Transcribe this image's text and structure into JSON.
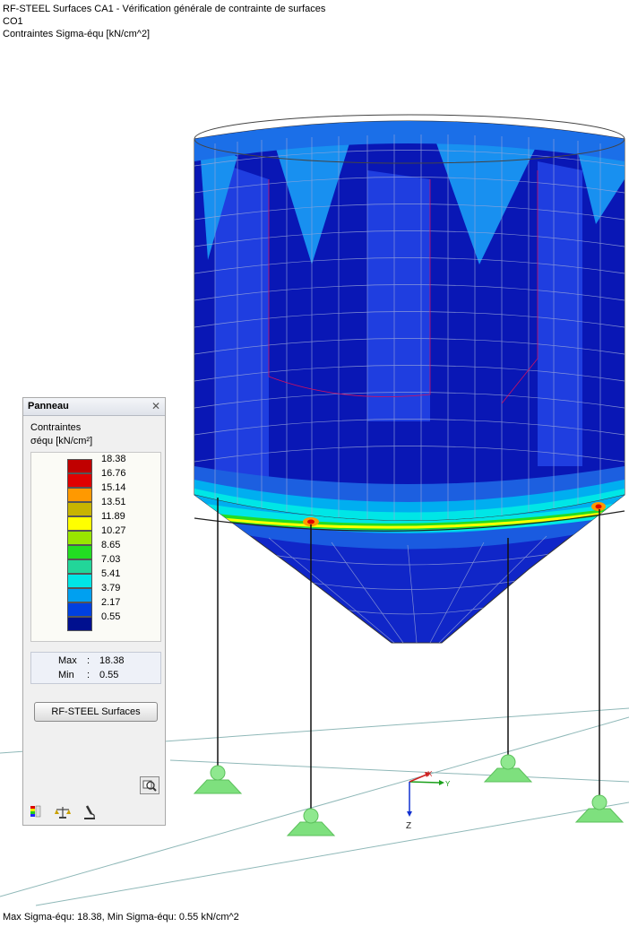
{
  "header": {
    "line1": "RF-STEEL Surfaces CA1 - Vérification générale de contrainte de surfaces",
    "line2": "CO1",
    "line3": "Contraintes Sigma-équ [kN/cm^2]"
  },
  "panel": {
    "title": "Panneau",
    "close_symbol": "✕",
    "section_label": "Contraintes",
    "unit_label": "σéqu [kN/cm²]",
    "legend": [
      {
        "value": "18.38",
        "color": "#c00000"
      },
      {
        "value": "16.76",
        "color": "#e00000"
      },
      {
        "value": "15.14",
        "color": "#ff9900"
      },
      {
        "value": "13.51",
        "color": "#c8b400"
      },
      {
        "value": "11.89",
        "color": "#ffff00"
      },
      {
        "value": "10.27",
        "color": "#99e600"
      },
      {
        "value": "8.65",
        "color": "#22dd22"
      },
      {
        "value": "7.03",
        "color": "#22d699"
      },
      {
        "value": "5.41",
        "color": "#00e6e6"
      },
      {
        "value": "3.79",
        "color": "#00a0f0"
      },
      {
        "value": "2.17",
        "color": "#0040e0"
      },
      {
        "value": "0.55",
        "color": "#00108f"
      }
    ],
    "max_label": "Max",
    "max_colon": ":",
    "max_value": "18.38",
    "min_label": "Min",
    "min_colon": ":",
    "min_value": "0.55",
    "button_label": "RF-STEEL Surfaces",
    "tabs": [
      "colors-tab-icon",
      "balance-tab-icon",
      "microscope-tab-icon"
    ]
  },
  "axes": {
    "x": "X",
    "y": "Y",
    "z": "Z"
  },
  "statusbar": "Max Sigma-équ: 18.38, Min Sigma-équ: 0.55 kN/cm^2"
}
